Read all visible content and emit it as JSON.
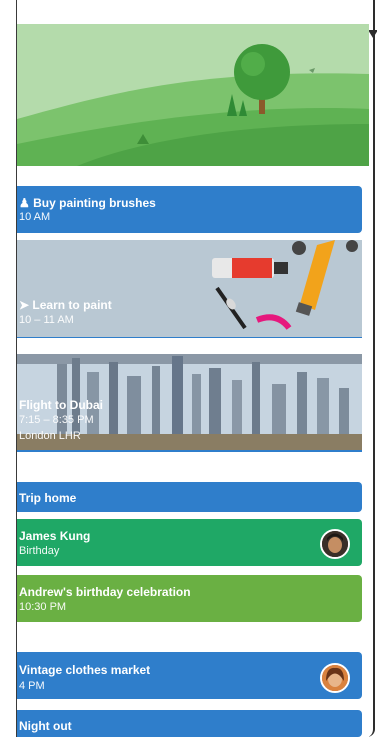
{
  "events": [
    {
      "title": "Buy painting brushes",
      "sub": "10 AM",
      "icon": "person-icon"
    },
    {
      "title": "Learn to paint",
      "sub": "10 – 11 AM",
      "icon": "paint-icon"
    },
    {
      "title": "Flight to Dubai",
      "sub": "7:15 – 8:35 PM",
      "sub2": "London LHR"
    },
    {
      "title": "Trip home"
    },
    {
      "title": "James Kung",
      "sub": "Birthday"
    },
    {
      "title": "Andrew's birthday celebration",
      "sub": "10:30 PM"
    },
    {
      "title": "Vintage clothes market",
      "sub": "4 PM"
    },
    {
      "title": "Night out"
    }
  ],
  "colors": {
    "blue": "#2f7ecb",
    "green": "#1fa866",
    "lime": "#6ab043"
  }
}
